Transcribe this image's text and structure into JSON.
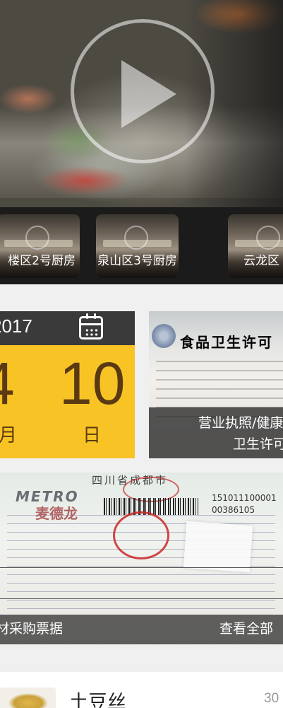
{
  "video": {
    "thumbnails": [
      {
        "label": "楼区2号厨房"
      },
      {
        "label": "泉山区3号厨房"
      },
      {
        "label": "云龙区"
      }
    ]
  },
  "date_card": {
    "year": "2017",
    "day_a": "4",
    "day_b": "10",
    "unit_month": "月",
    "unit_day": "日"
  },
  "license_card": {
    "doc_title": "食品卫生许可",
    "caption_line1": "营业执照/健康",
    "caption_line2": "卫生许可"
  },
  "receipt_card": {
    "doc_header": "四川省成都市",
    "logo_text": "METRO",
    "logo_cn": "麦德龙",
    "code_text": "151011100001\n00386105",
    "caption": "材采购票据",
    "view_all": "查看全部"
  },
  "dish": {
    "name": "土豆丝",
    "price": "30"
  },
  "colors": {
    "date_top": "#3a3a3a",
    "date_body": "#f8c425",
    "date_text": "#5a3a12"
  }
}
